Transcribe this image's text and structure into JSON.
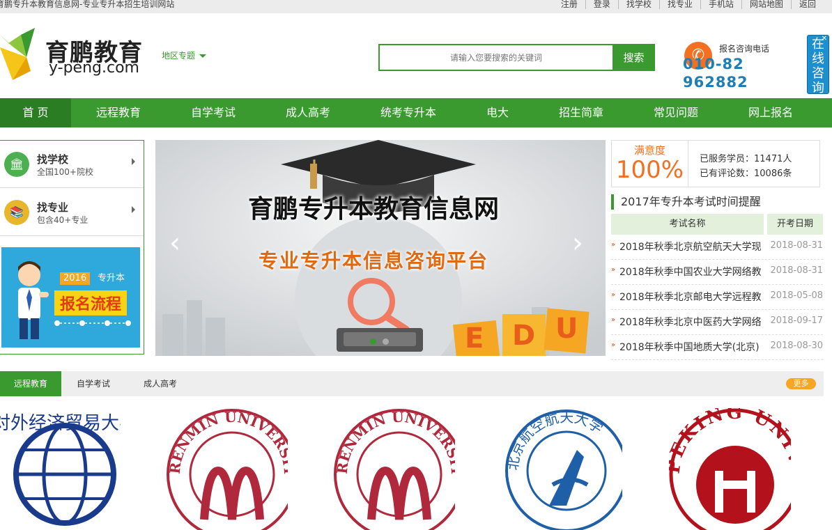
{
  "topbar": {
    "site_title": "育鹏专升本教育信息网-专业专升本招生培训网站",
    "links": [
      "注册",
      "登录",
      "找学校",
      "找专业",
      "手机站",
      "网站地图",
      "返回"
    ]
  },
  "header": {
    "logo_cn": "育鹏教育",
    "logo_en": "y-peng.com",
    "region": "地区专题",
    "search_placeholder": "请输入您要搜索的关键词",
    "search_button": "搜索",
    "phone_label": "报名咨询电话",
    "phone_number": "010-82962882",
    "online_consult": "在线咨询"
  },
  "nav": [
    "首 页",
    "远程教育",
    "自学考试",
    "成人高考",
    "统考专升本",
    "电大",
    "招生简章",
    "常见问题",
    "网上报名"
  ],
  "left_panel": {
    "find_school": {
      "title": "找学校",
      "sub": "全国100+院校"
    },
    "find_major": {
      "title": "找专业",
      "sub": "包含40+专业"
    },
    "promo": {
      "year": "2016",
      "tag": "专升本",
      "title": "报名流程"
    }
  },
  "banner": {
    "title": "育鹏专升本教育信息网",
    "subtitle": "专业专升本信息咨询平台",
    "letters": [
      "E",
      "D",
      "U"
    ]
  },
  "stats": {
    "satisfaction_label": "满意度",
    "satisfaction_value": "100%",
    "served": "已服务学员：11471人",
    "reviews": "已有评论数：10086条"
  },
  "exam_reminder": {
    "title": "2017年专升本考试时间提醒",
    "col_name": "考试名称",
    "col_date": "开考日期",
    "rows": [
      {
        "name": "2018年秋季北京航空航天大学现",
        "date": "2018-08-31"
      },
      {
        "name": "2018年秋季中国农业大学网络教",
        "date": "2018-08-31"
      },
      {
        "name": "2018年秋季北京邮电大学远程教",
        "date": "2018-05-08"
      },
      {
        "name": "2018年秋季北京中医药大学网络",
        "date": "2018-09-17"
      },
      {
        "name": "2018年秋季中国地质大学(北京)",
        "date": "2018-08-30"
      }
    ]
  },
  "tabs": [
    "远程教育",
    "自学考试",
    "成人高考"
  ],
  "more": "更多",
  "universities": [
    {
      "text": "对外经济贸易大学"
    },
    {
      "text": "RENMIN UNIVERSITY OF CHINA"
    },
    {
      "text": "RENMIN UNIVERSITY OF CHINA"
    },
    {
      "text": "北京航空航天大学"
    },
    {
      "text": "PEKING UNIVERSITY"
    }
  ],
  "colors": {
    "brand_green": "#3a9a2f",
    "orange": "#f37021",
    "blue": "#1d7fb5"
  }
}
